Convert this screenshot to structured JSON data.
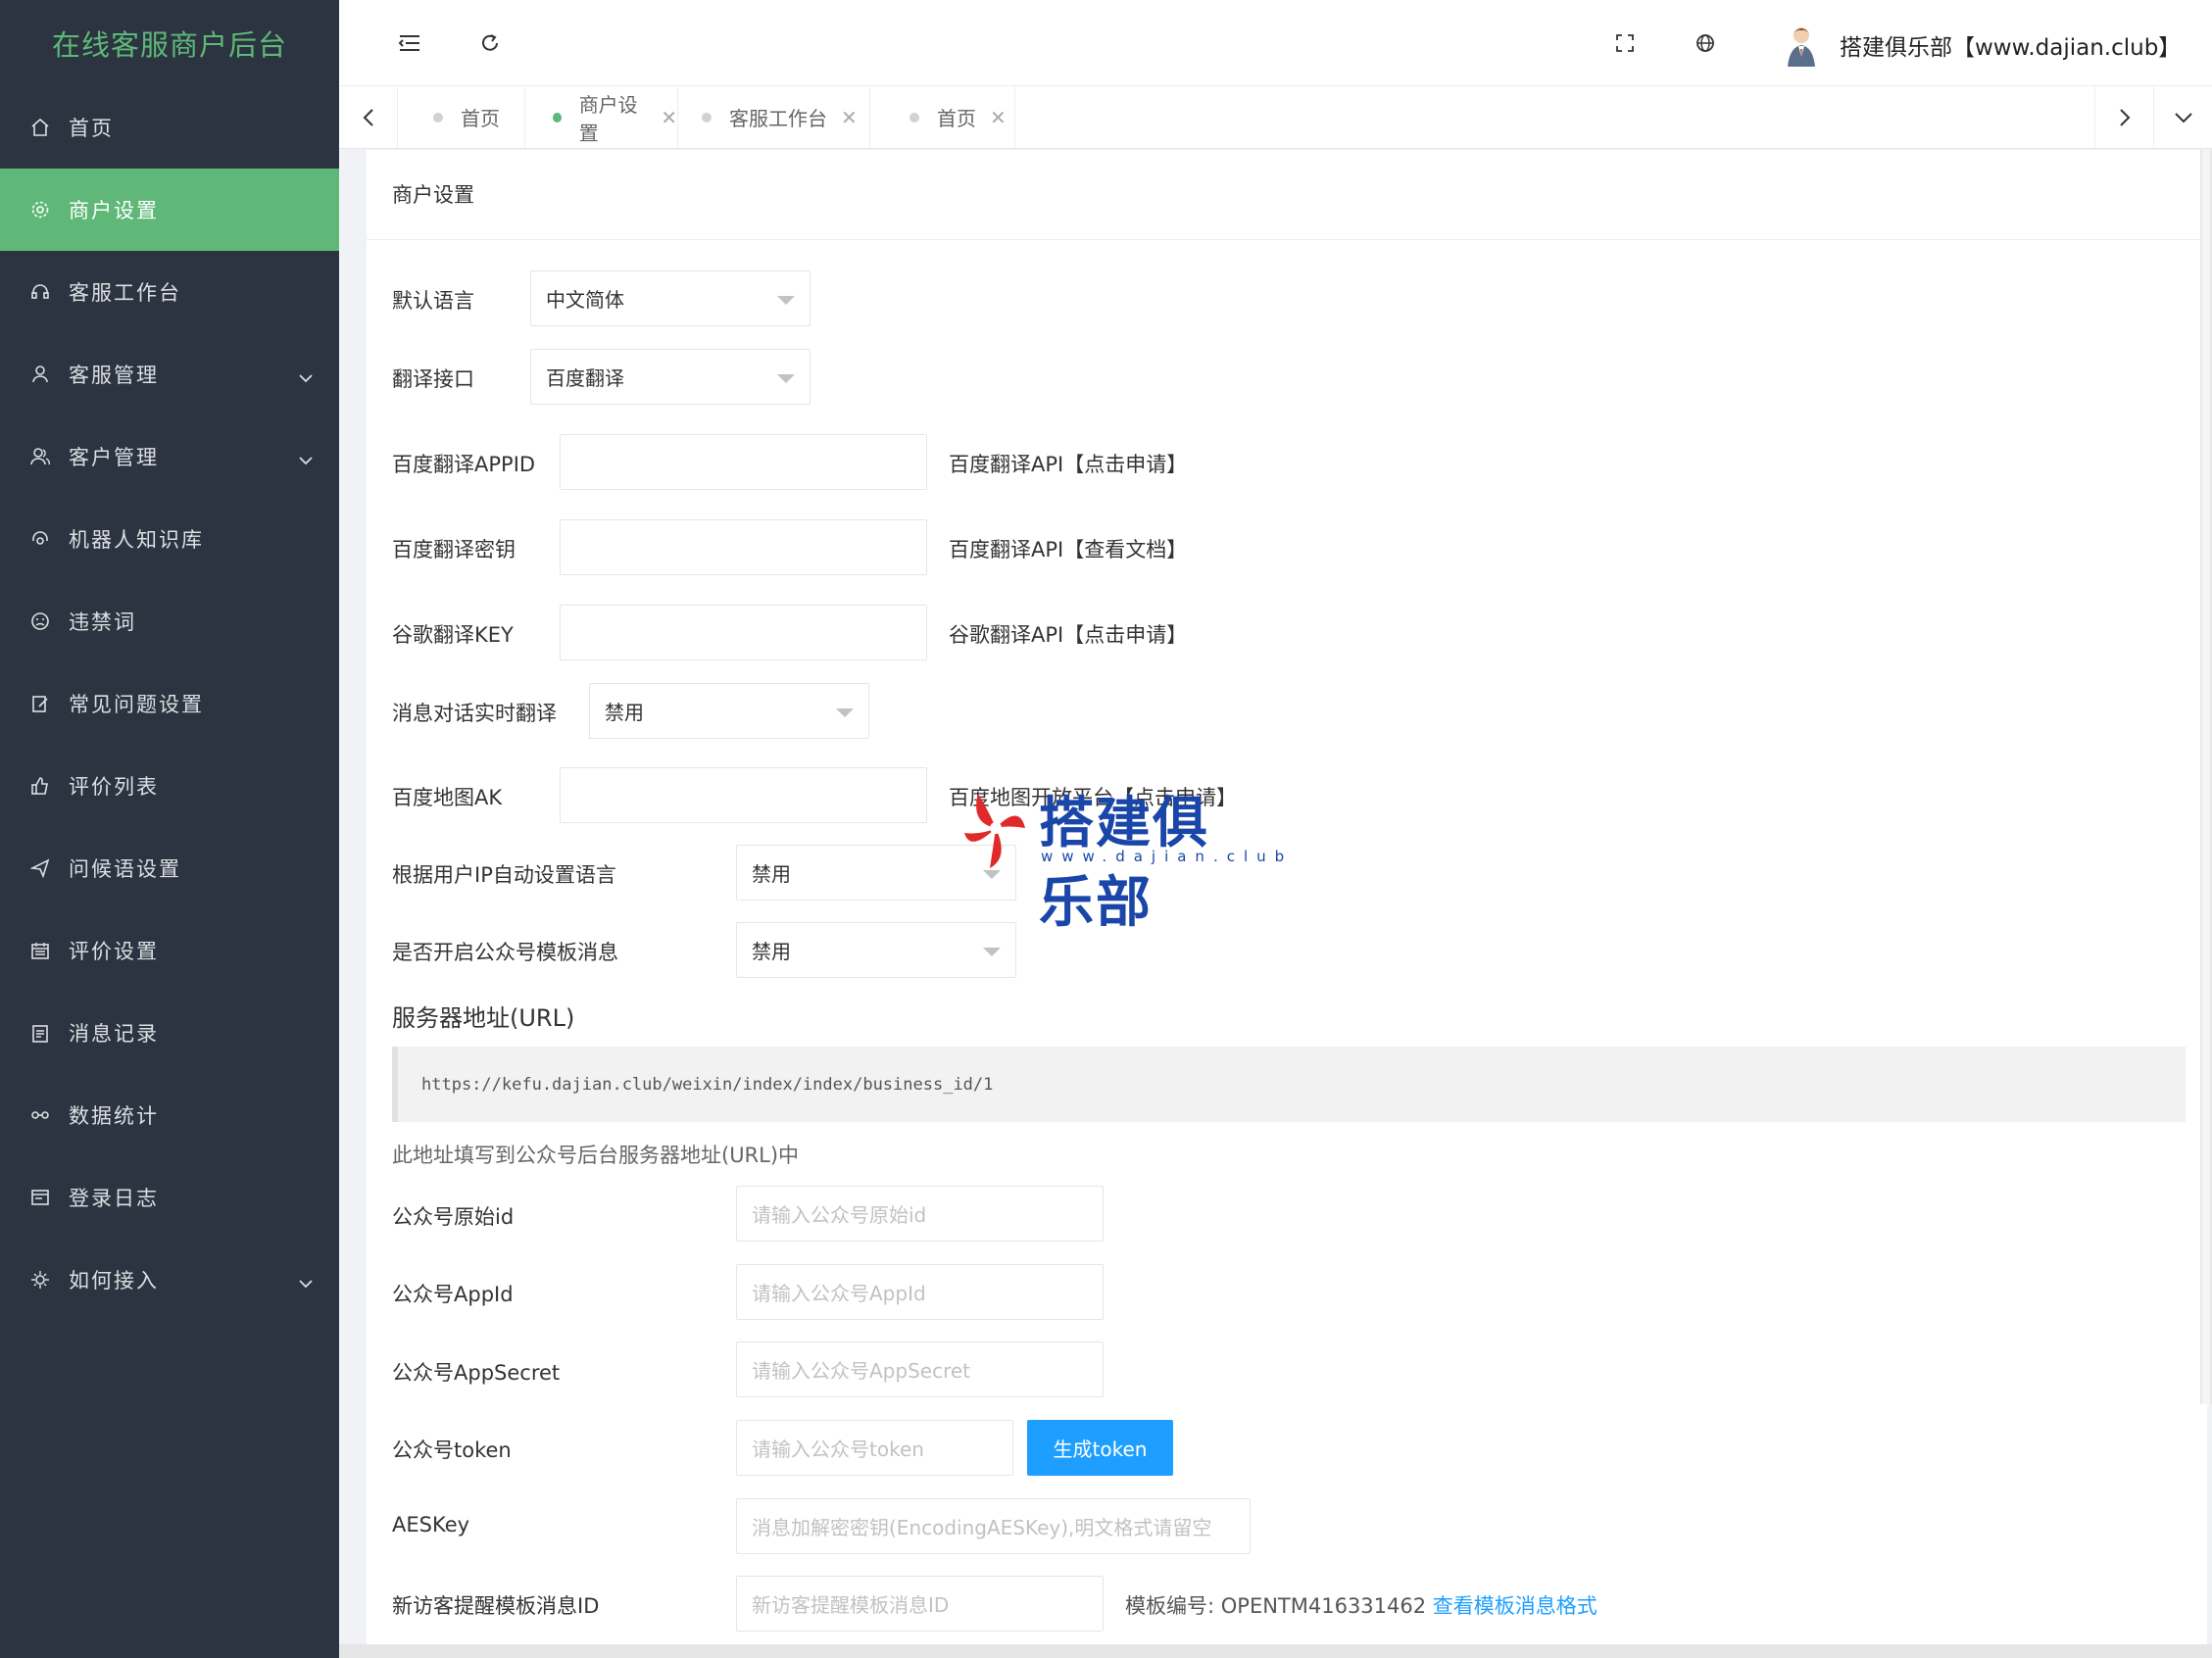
{
  "app": {
    "title": "在线客服商户后台"
  },
  "sidebar": {
    "items": [
      {
        "label": "首页",
        "icon": "home-icon"
      },
      {
        "label": "商户设置",
        "icon": "gear-icon",
        "active": true
      },
      {
        "label": "客服工作台",
        "icon": "headset-icon"
      },
      {
        "label": "客服管理",
        "icon": "user-icon",
        "expandable": true
      },
      {
        "label": "客户管理",
        "icon": "users-icon",
        "expandable": true
      },
      {
        "label": "机器人知识库",
        "icon": "robot-icon"
      },
      {
        "label": "违禁词",
        "icon": "face-icon"
      },
      {
        "label": "常见问题设置",
        "icon": "edit-icon"
      },
      {
        "label": "评价列表",
        "icon": "thumb-up-icon"
      },
      {
        "label": "问候语设置",
        "icon": "send-icon"
      },
      {
        "label": "评价设置",
        "icon": "calendar-icon"
      },
      {
        "label": "消息记录",
        "icon": "clipboard-icon"
      },
      {
        "label": "数据统计",
        "icon": "chart-icon"
      },
      {
        "label": "登录日志",
        "icon": "log-icon"
      },
      {
        "label": "如何接入",
        "icon": "plugin-icon",
        "expandable": true
      }
    ]
  },
  "header": {
    "user_name": "搭建俱乐部【www.dajian.club】"
  },
  "tabs": [
    {
      "label": "首页",
      "closable": false
    },
    {
      "label": "商户设置",
      "closable": true,
      "active": true
    },
    {
      "label": "客服工作台",
      "closable": true
    },
    {
      "label": "首页",
      "closable": true
    }
  ],
  "page": {
    "title": "商户设置",
    "fields": {
      "default_language": {
        "label": "默认语言",
        "value": "中文简体"
      },
      "translate_api": {
        "label": "翻译接口",
        "value": "百度翻译"
      },
      "baidu_appid": {
        "label": "百度翻译APPID",
        "value": "",
        "aux": "百度翻译API【点击申请】"
      },
      "baidu_secret": {
        "label": "百度翻译密钥",
        "value": "",
        "aux": "百度翻译API【查看文档】"
      },
      "google_key": {
        "label": "谷歌翻译KEY",
        "value": "",
        "aux": "谷歌翻译API【点击申请】"
      },
      "realtime_translate": {
        "label": "消息对话实时翻译",
        "value": "禁用"
      },
      "baidu_map_ak": {
        "label": "百度地图AK",
        "value": "",
        "aux": "百度地图开放平台【点击申请】"
      },
      "auto_lang_by_ip": {
        "label": "根据用户IP自动设置语言",
        "value": "禁用"
      },
      "mp_template_msg": {
        "label": "是否开启公众号模板消息",
        "value": "禁用"
      }
    },
    "server_url_section": {
      "title": "服务器地址(URL)",
      "url": "https://kefu.dajian.club/weixin/index/index/business_id/1",
      "hint": "此地址填写到公众号后台服务器地址(URL)中"
    },
    "mp_fields": {
      "original_id": {
        "label": "公众号原始id",
        "placeholder": "请输入公众号原始id"
      },
      "appid": {
        "label": "公众号AppId",
        "placeholder": "请输入公众号AppId"
      },
      "appsecret": {
        "label": "公众号AppSecret",
        "placeholder": "请输入公众号AppSecret"
      },
      "token": {
        "label": "公众号token",
        "placeholder": "请输入公众号token",
        "button": "生成token"
      },
      "aeskey": {
        "label": "AESKey",
        "placeholder": "消息加解密密钥(EncodingAESKey),明文格式请留空"
      },
      "visitor_tpl": {
        "label": "新访客提醒模板消息ID",
        "placeholder": "新访客提醒模板消息ID",
        "aux_prefix": "模板编号: OPENTM416331462 ",
        "aux_link": "查看模板消息格式"
      }
    }
  },
  "watermark": {
    "text": "搭建俱乐部",
    "sub": "www.dajian.club"
  },
  "colors": {
    "sidebar_bg": "#2b3440",
    "accent": "#5fb878",
    "link": "#1e9fff"
  }
}
